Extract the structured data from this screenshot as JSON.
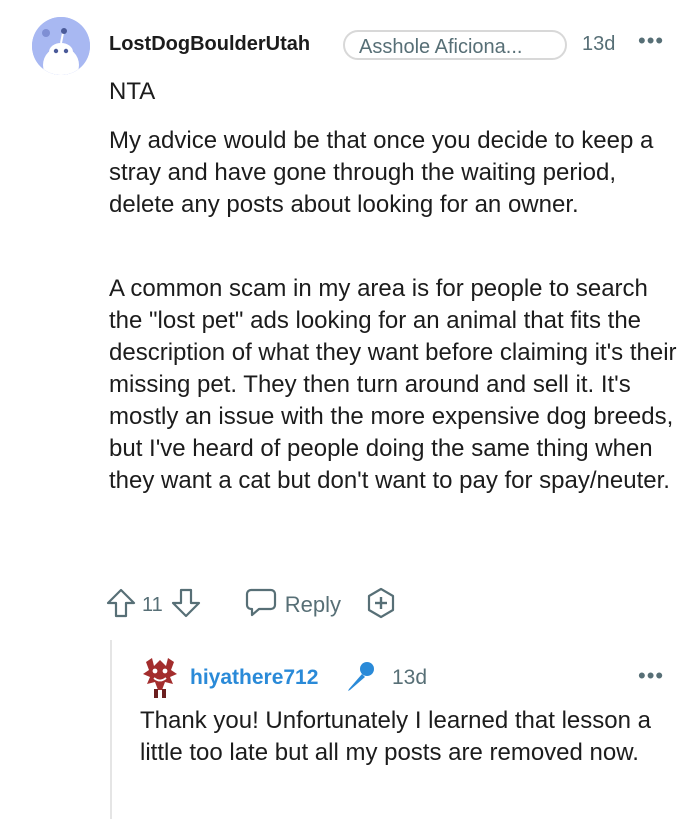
{
  "comment": {
    "username": "LostDogBoulderUtah",
    "flair": "Asshole Aficiona...",
    "time": "13d",
    "more": "•••",
    "paragraphs": [
      "NTA",
      "My advice would be that once you decide to keep a stray and have gone through the waiting period, delete any posts about looking for an owner.",
      "A common scam in my area is for people to search the \"lost pet\" ads looking for an animal that fits the description of what they want before claiming it's their missing pet. They then turn around and sell it. It's mostly an issue with the more expensive dog breeds, but I've heard of people doing the same thing when they want a cat but don't want to pay for spay/neuter."
    ],
    "vote_count": "11",
    "reply_label": "Reply"
  },
  "reply": {
    "username": "hiyathere712",
    "time": "13d",
    "more": "•••",
    "text": "Thank you! Unfortunately I learned that lesson a little too late but all my posts are removed now."
  },
  "colors": {
    "meta": "#576f76",
    "reply_username": "#2a8ad8",
    "avatar_bg": "#a8b8f2",
    "mic": "#2a8ad8"
  },
  "icons": [
    "snoo-avatar",
    "upvote-icon",
    "downvote-icon",
    "comment-bubble-icon",
    "award-plus-icon",
    "demon-avatar",
    "microphone-icon"
  ]
}
